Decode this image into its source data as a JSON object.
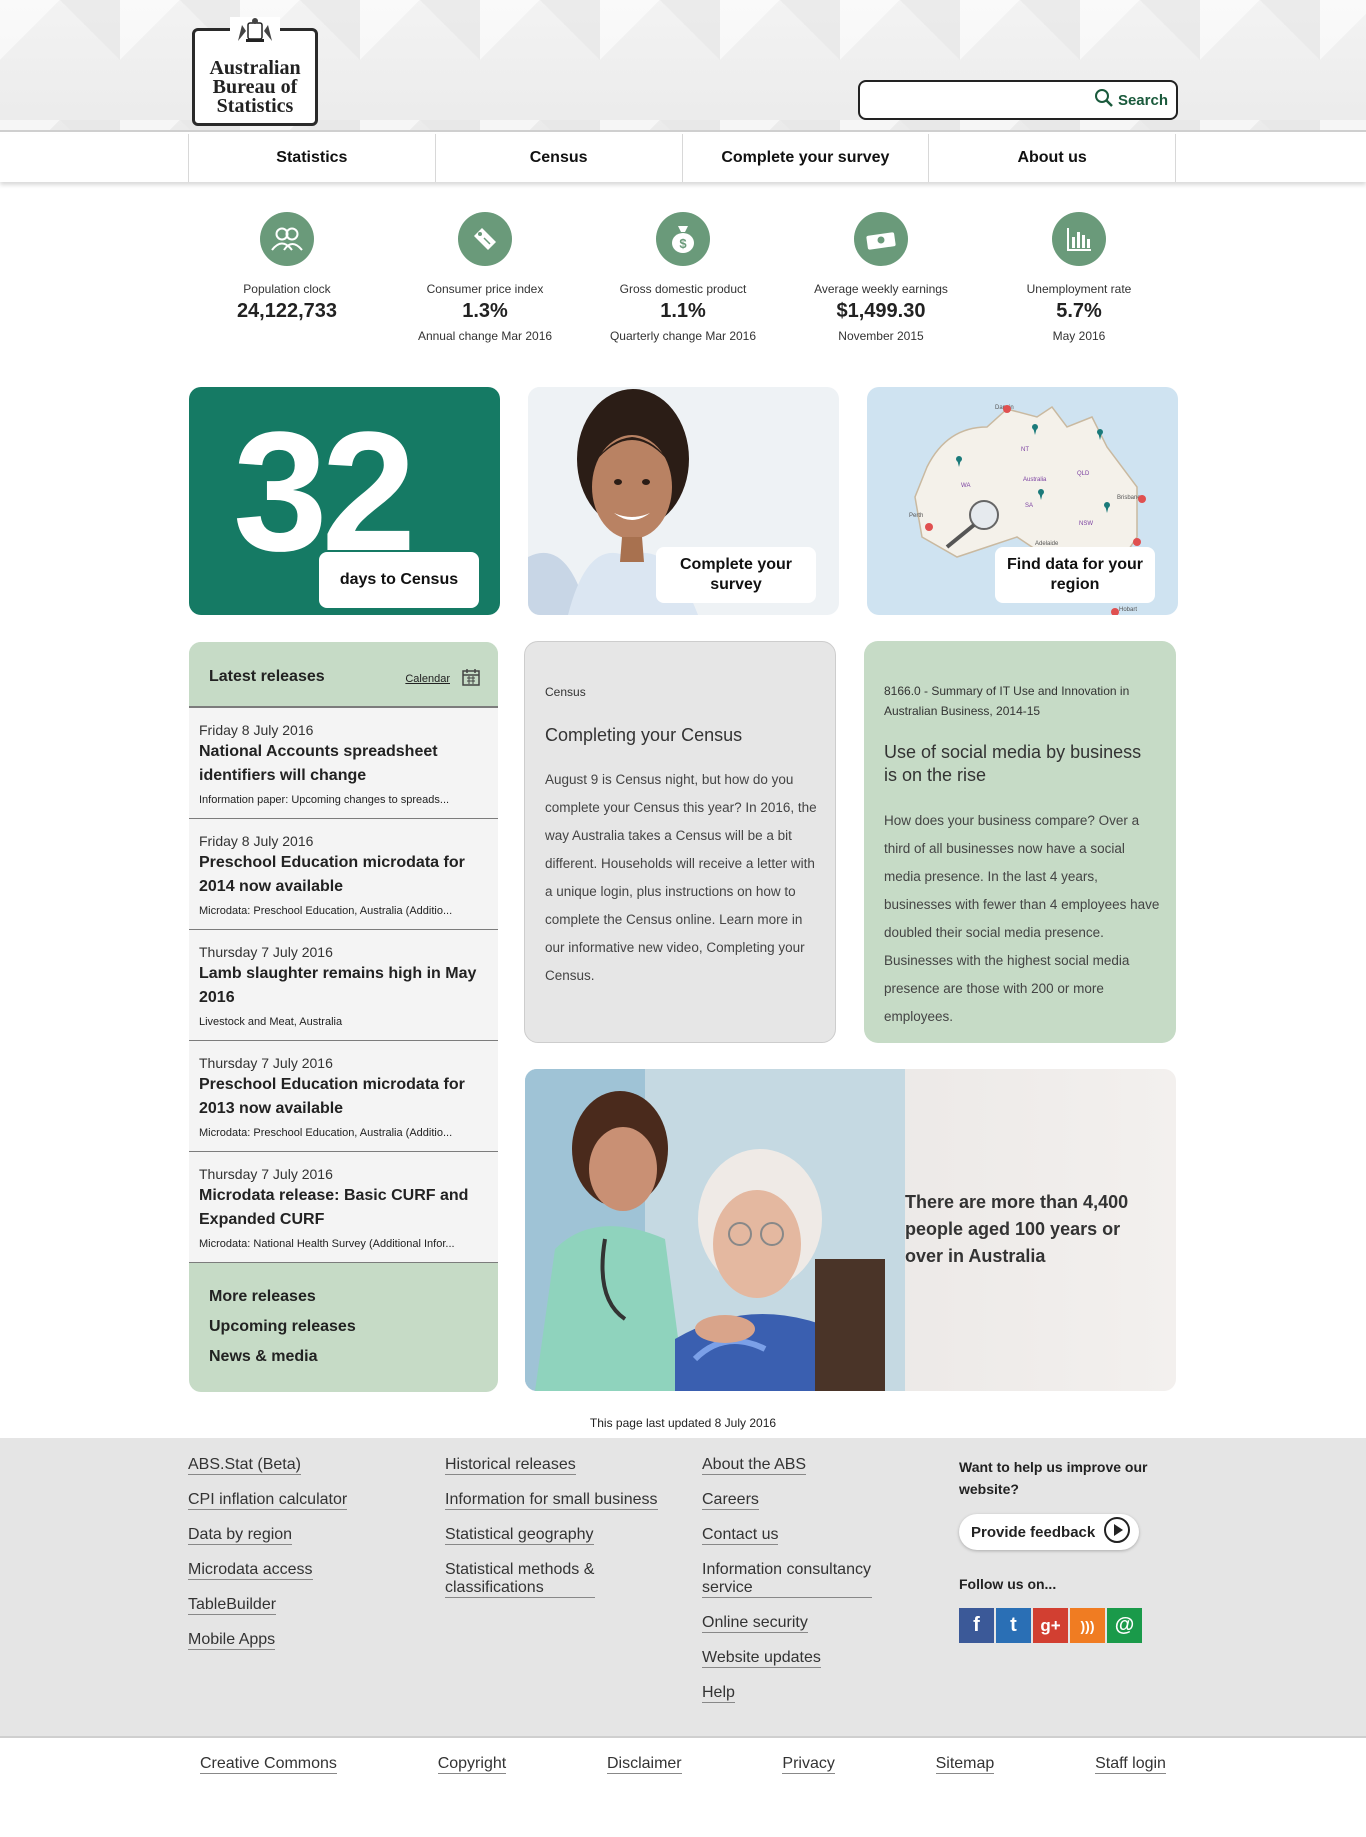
{
  "header": {
    "logo_lines": [
      "Australian",
      "Bureau of",
      "Statistics"
    ],
    "search_placeholder": "",
    "search_label": "Search"
  },
  "nav": [
    "Statistics",
    "Census",
    "Complete your survey",
    "About us"
  ],
  "stats": [
    {
      "icon": "people-icon",
      "label": "Population clock",
      "value": "24,122,733",
      "sub": ""
    },
    {
      "icon": "price-tag-icon",
      "label": "Consumer price index",
      "value": "1.3%",
      "sub": "Annual change Mar 2016"
    },
    {
      "icon": "money-bag-icon",
      "label": "Gross domestic product",
      "value": "1.1%",
      "sub": "Quarterly change Mar 2016"
    },
    {
      "icon": "cash-icon",
      "label": "Average weekly earnings",
      "value": "$1,499.30",
      "sub": "November 2015"
    },
    {
      "icon": "bar-chart-icon",
      "label": "Unemployment rate",
      "value": "5.7%",
      "sub": "May 2016"
    }
  ],
  "tiles": {
    "census_days": "32",
    "census_caption": "days to Census",
    "survey_caption": "Complete your survey",
    "map_caption": "Find data for your region",
    "map_labels": [
      "Darwin",
      "NT",
      "WA",
      "Australia",
      "QLD",
      "SA",
      "NSW",
      "Perth",
      "Brisbane",
      "Adelaide",
      "Hobart"
    ]
  },
  "releases": {
    "title": "Latest releases",
    "calendar_label": "Calendar",
    "items": [
      {
        "date": "Friday 8 July 2016",
        "headline": "National Accounts spreadsheet identifiers will change",
        "sub": "Information paper: Upcoming changes to spreads..."
      },
      {
        "date": "Friday 8 July 2016",
        "headline": "Preschool Education microdata for 2014 now available",
        "sub": "Microdata: Preschool Education, Australia (Additio..."
      },
      {
        "date": "Thursday 7 July 2016",
        "headline": "Lamb slaughter remains high in May 2016",
        "sub": "Livestock and Meat, Australia"
      },
      {
        "date": "Thursday 7 July 2016",
        "headline": "Preschool Education microdata for 2013 now available",
        "sub": "Microdata: Preschool Education, Australia (Additio..."
      },
      {
        "date": "Thursday 7 July 2016",
        "headline": "Microdata release: Basic CURF and Expanded CURF",
        "sub": "Microdata: National Health Survey (Additional Infor..."
      }
    ],
    "links": [
      "More releases",
      "Upcoming releases",
      "News & media"
    ]
  },
  "cards": {
    "census": {
      "kicker": "Census",
      "title": "Completing your Census",
      "body": "August 9 is Census night, but how do you complete your Census this year? In 2016, the way Australia takes a Census will be a bit different. Households will receive a letter with a unique login, plus instructions on how to complete the Census online. Learn more in our informative new video, Completing your Census."
    },
    "social": {
      "kicker": "8166.0 - Summary of IT Use and Innovation in Australian Business, 2014-15",
      "title": "Use of social media by business is on the rise",
      "body": "How does your business compare? Over a third of all businesses now have a social media presence. In the last 4 years, businesses with fewer than 4 employees have doubled their social media presence. Businesses with the highest social media presence are those with 200 or more employees."
    }
  },
  "aged_text": "There are more than 4,400 people aged 100 years or over in Australia",
  "last_updated": "This page last updated 8 July 2016",
  "footer": {
    "col1": [
      "ABS.Stat (Beta)",
      "CPI inflation calculator",
      "Data by region",
      "Microdata access",
      "TableBuilder",
      "Mobile Apps"
    ],
    "col2": [
      "Historical releases",
      "Information for small business",
      "Statistical geography",
      "Statistical methods & classifications"
    ],
    "col3": [
      "About the ABS",
      "Careers",
      "Contact us",
      "Information consultancy service",
      "Online security",
      "Website updates",
      "Help"
    ],
    "feedback_question": "Want to help us improve our website?",
    "feedback_button": "Provide feedback",
    "follow_label": "Follow us on...",
    "social": [
      {
        "name": "facebook-icon",
        "glyph": "f",
        "color": "#3b5998"
      },
      {
        "name": "twitter-icon",
        "glyph": "t",
        "color": "#2a6fb5"
      },
      {
        "name": "google-plus-icon",
        "glyph": "g+",
        "color": "#d23f31"
      },
      {
        "name": "rss-icon",
        "glyph": ")))",
        "color": "#f07c22"
      },
      {
        "name": "email-icon",
        "glyph": "@",
        "color": "#1a9a4a"
      }
    ]
  },
  "bottom_links": [
    "Creative Commons",
    "Copyright",
    "Disclaimer",
    "Privacy",
    "Sitemap",
    "Staff login"
  ],
  "colors": {
    "accent": "#157a64",
    "stat_circle": "#6a9a7a",
    "panel_green": "#c6dbc6"
  }
}
